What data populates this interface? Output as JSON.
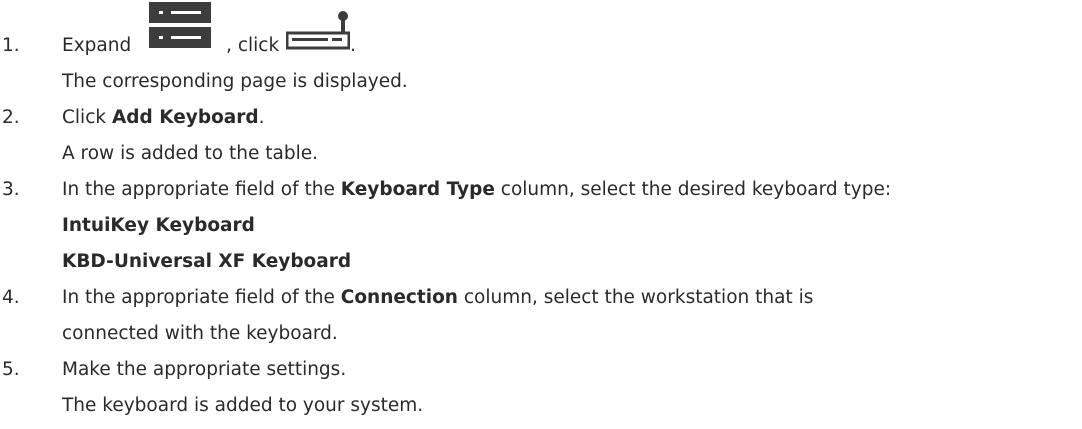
{
  "steps": [
    {
      "number": "1.",
      "text_a": "Expand ",
      "text_b": ", click ",
      "text_c": ".",
      "icon_1": "server-list-icon",
      "icon_2": "keyboard-joystick-icon",
      "result": "The corresponding page is displayed."
    },
    {
      "number": "2.",
      "text_a": "Click ",
      "bold": "Add Keyboard",
      "text_b": ".",
      "result": "A row is added to the table."
    },
    {
      "number": "3.",
      "text_a": "In the appropriate field of the ",
      "bold": "Keyboard Type",
      "text_b": " column, select the desired keyboard type:",
      "options": [
        "IntuiKey Keyboard",
        "KBD-Universal XF Keyboard"
      ]
    },
    {
      "number": "4.",
      "text_a": "In the appropriate field of the ",
      "bold": "Connection",
      "text_b": " column, select the workstation that is",
      "text_c": "connected with the keyboard."
    },
    {
      "number": "5.",
      "text_a": "Make the appropriate settings.",
      "result": "The keyboard is added to your system."
    }
  ],
  "colors": {
    "text": "#2a2a2a",
    "icon": "#3c3c3c"
  }
}
